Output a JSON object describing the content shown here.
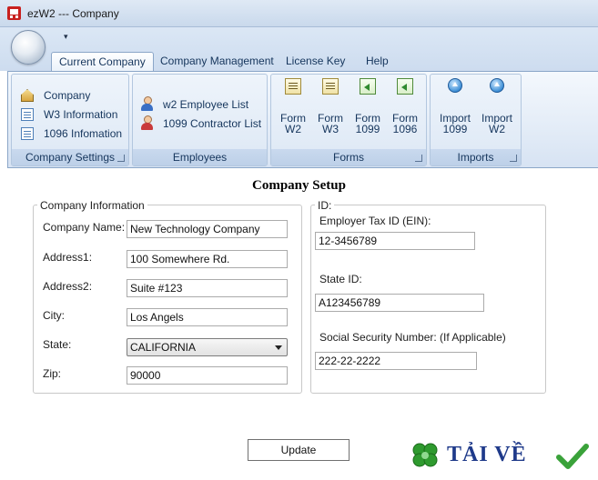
{
  "window": {
    "title": "ezW2 --- Company"
  },
  "qat": {
    "dropdown_glyph": "▾"
  },
  "tabs": [
    {
      "label": "Current Company",
      "active": true
    },
    {
      "label": "Company Management",
      "active": false
    },
    {
      "label": "License Key",
      "active": false
    },
    {
      "label": "Help",
      "active": false
    }
  ],
  "ribbon": {
    "company_settings": {
      "label": "Company Settings",
      "items": [
        "Company",
        "W3 Information",
        "1096 Infomation"
      ]
    },
    "employees": {
      "label": "Employees",
      "items": [
        "w2 Employee List",
        "1099 Contractor List"
      ]
    },
    "forms": {
      "label": "Forms",
      "items": [
        {
          "line1": "Form",
          "line2": "W2"
        },
        {
          "line1": "Form",
          "line2": "W3"
        },
        {
          "line1": "Form",
          "line2": "1099"
        },
        {
          "line1": "Form",
          "line2": "1096"
        }
      ]
    },
    "imports": {
      "label": "Imports",
      "items": [
        {
          "line1": "Import",
          "line2": "1099"
        },
        {
          "line1": "Import",
          "line2": "W2"
        }
      ]
    }
  },
  "main": {
    "title": "Company Setup",
    "company_info": {
      "legend": "Company Information",
      "fields": {
        "company_name": {
          "label": "Company Name:",
          "value": "New Technology Company"
        },
        "address1": {
          "label": "Address1:",
          "value": "100 Somewhere Rd."
        },
        "address2": {
          "label": "Address2:",
          "value": "Suite #123"
        },
        "city": {
          "label": "City:",
          "value": "Los Angels"
        },
        "state": {
          "label": "State:",
          "value": "CALIFORNIA"
        },
        "zip": {
          "label": "Zip:",
          "value": "90000"
        }
      }
    },
    "id_info": {
      "legend": "ID:",
      "fields": {
        "ein": {
          "label": "Employer Tax ID (EIN):",
          "value": "12-3456789"
        },
        "state_id": {
          "label": "State ID:",
          "value": "A123456789"
        },
        "ssn": {
          "label": "Social Security Number: (If Applicable)",
          "value": "222-22-2222"
        }
      }
    },
    "update_button": "Update"
  },
  "watermark": {
    "text": "TẢI VỀ"
  },
  "colors": {
    "ribbon_text": "#15355c",
    "watermark_blue": "#1f3a8a",
    "clover_green": "#2e9a2e",
    "check_green": "#3aa23a"
  }
}
